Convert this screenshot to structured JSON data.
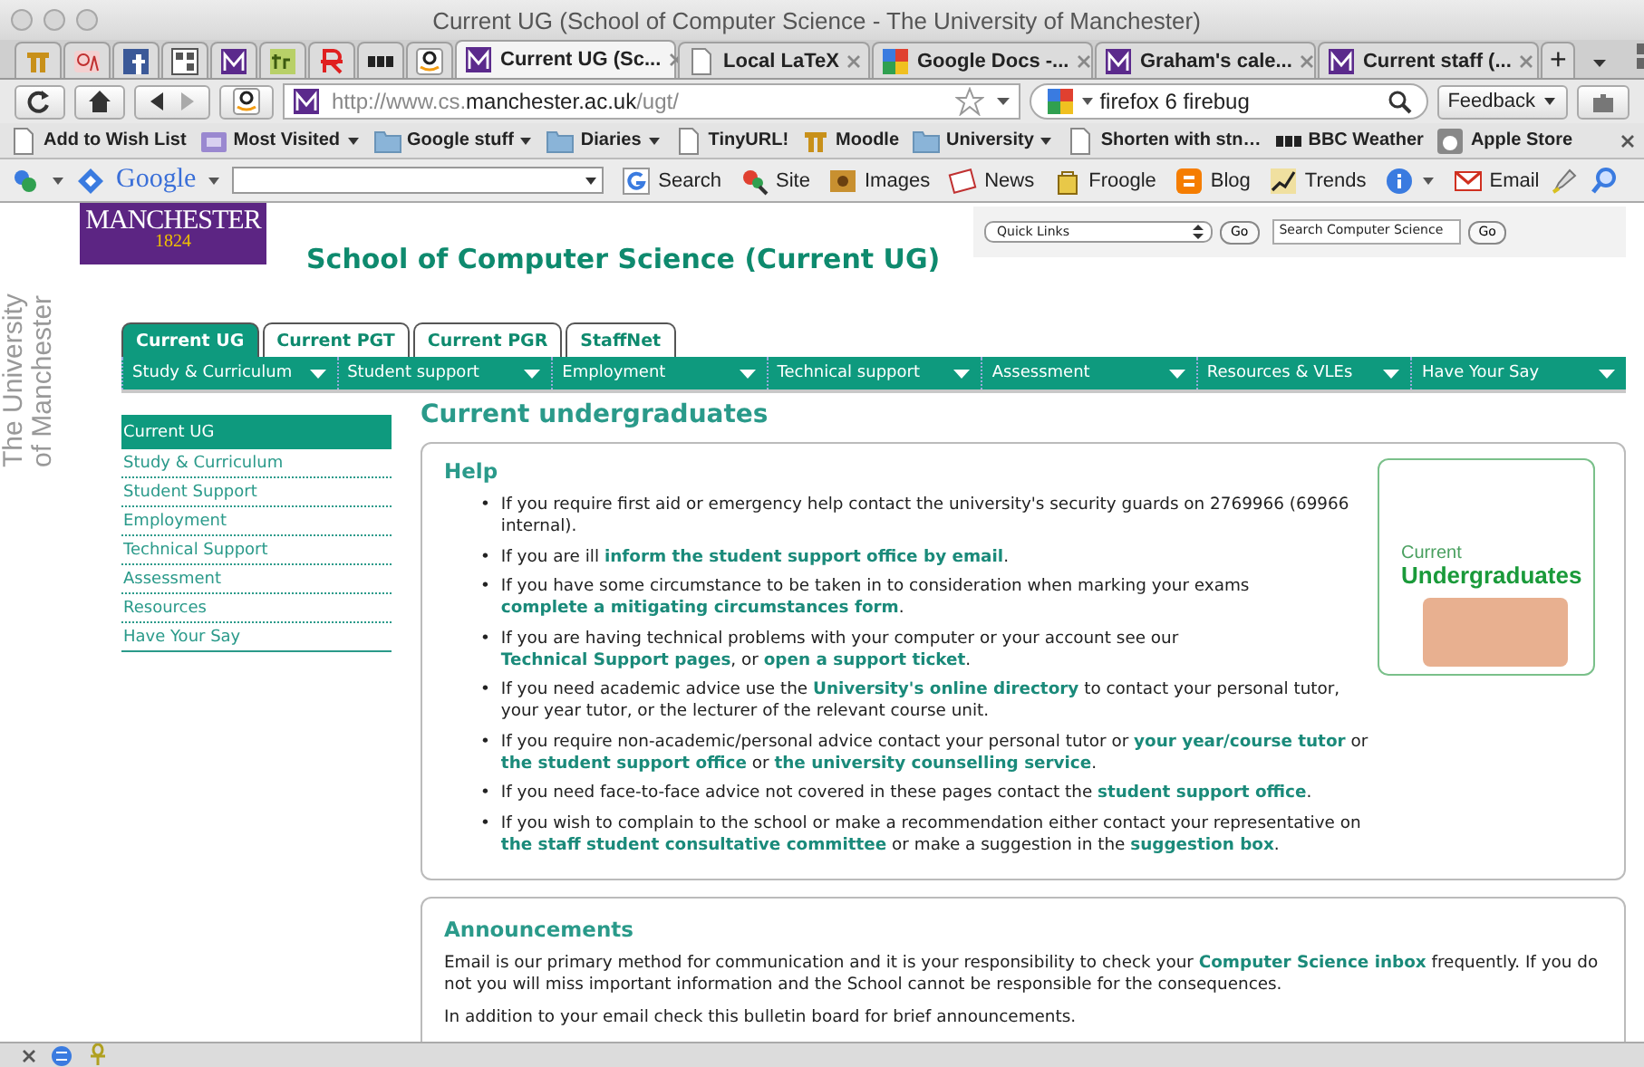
{
  "window": {
    "title": "Current UG (School of Computer Science - The University of Manchester)"
  },
  "browser_tabs": [
    {
      "kind": "pinned",
      "selected": false
    },
    {
      "kind": "pinned",
      "selected": false
    },
    {
      "kind": "pinned",
      "selected": false
    },
    {
      "kind": "pinned",
      "selected": false
    },
    {
      "kind": "pinned",
      "selected": false
    },
    {
      "kind": "pinned",
      "selected": false
    },
    {
      "kind": "pinned",
      "selected": false
    },
    {
      "kind": "pinned",
      "selected": false
    },
    {
      "kind": "pinned",
      "selected": false
    },
    {
      "kind": "tab",
      "label": "Current UG (Sc...",
      "selected": true
    },
    {
      "kind": "tab",
      "label": "Local LaTeX",
      "selected": false
    },
    {
      "kind": "tab",
      "label": "Google Docs -...",
      "selected": false
    },
    {
      "kind": "tab",
      "label": "Graham's cale...",
      "selected": false
    },
    {
      "kind": "tab",
      "label": "Current staff (...",
      "selected": false
    }
  ],
  "new_tab": "+",
  "navigation": {
    "url_prefix": "http://www.cs.",
    "url_host": "manchester.ac.uk",
    "url_path": "/ugt/",
    "search_value": "firefox 6 firebug",
    "feedback": "Feedback"
  },
  "bookmarks": [
    {
      "kind": "page",
      "label": "Add to Wish List",
      "dropdown": false
    },
    {
      "kind": "smart",
      "label": "Most Visited",
      "dropdown": true
    },
    {
      "kind": "folder",
      "label": "Google stuff",
      "dropdown": true
    },
    {
      "kind": "folder",
      "label": "Diaries",
      "dropdown": true
    },
    {
      "kind": "page",
      "label": "TinyURL!",
      "dropdown": false
    },
    {
      "kind": "site",
      "label": "Moodle",
      "dropdown": false
    },
    {
      "kind": "folder",
      "label": "University",
      "dropdown": true
    },
    {
      "kind": "page",
      "label": "Shorten with stn…",
      "dropdown": false
    },
    {
      "kind": "bbc",
      "label": "BBC Weather",
      "dropdown": false
    },
    {
      "kind": "apple",
      "label": "Apple Store",
      "dropdown": false
    }
  ],
  "google_toolbar": {
    "brand": "Google",
    "items": [
      {
        "kind": "search",
        "label": "Search"
      },
      {
        "kind": "site",
        "label": "Site"
      },
      {
        "kind": "images",
        "label": "Images"
      },
      {
        "kind": "news",
        "label": "News"
      },
      {
        "kind": "froogle",
        "label": "Froogle"
      },
      {
        "kind": "blog",
        "label": "Blog"
      },
      {
        "kind": "trends",
        "label": "Trends"
      },
      {
        "kind": "info"
      },
      {
        "kind": "email",
        "label": "Email"
      }
    ]
  },
  "site": {
    "logo_name": "MANCHESTER",
    "logo_year": "1824",
    "side_brand": [
      "The University",
      "of Manchester"
    ],
    "title": "School of Computer Science (Current UG)",
    "quick_links": "Quick Links",
    "go": "Go",
    "search_value": "Search Computer Science",
    "search_go": "Go"
  },
  "site_tabs": [
    {
      "label": "Current UG",
      "selected": true
    },
    {
      "label": "Current PGT",
      "selected": false
    },
    {
      "label": "Current PGR",
      "selected": false
    },
    {
      "label": "StaffNet",
      "selected": false
    }
  ],
  "menu": [
    "Study & Curriculum",
    "Student support",
    "Employment",
    "Technical support",
    "Assessment",
    "Resources & VLEs",
    "Have Your Say"
  ],
  "sidebar": [
    {
      "label": "Current UG",
      "selected": true
    },
    {
      "label": "Study & Curriculum",
      "selected": false
    },
    {
      "label": "Student Support",
      "selected": false
    },
    {
      "label": "Employment",
      "selected": false
    },
    {
      "label": "Technical Support",
      "selected": false
    },
    {
      "label": "Assessment",
      "selected": false
    },
    {
      "label": "Resources",
      "selected": false
    },
    {
      "label": "Have Your Say",
      "selected": false
    }
  ],
  "heading": "Current undergraduates",
  "help": {
    "title": "Help",
    "bullet": "•",
    "promo": [
      "Current",
      "Undergraduates"
    ],
    "items": [
      "If you require first aid or emergency help contact the university's security guards on 2769966 (69966 internal).",
      "If you are ill **inform the student support office by email**.",
      "If you have some circumstance to be taken in to consideration when marking your exams **complete a mitigating circumstances form**.",
      "If you are having technical problems with your computer or your account see our **Technical Support pages**, or **open a support ticket**.",
      "If you need academic advice use the **University's online directory** to contact your personal tutor, your year tutor, or the lecturer of the relevant course unit.",
      "If you require non-academic/personal advice contact your personal tutor or **your year/course tutor** or **the student support office** or **the university counselling service**.",
      "If you need face-to-face advice not covered in these pages contact the **student support office**.",
      "If you wish to complain to the school or make a recommendation either contact your representative on **the staff student consultative committee** or make a suggestion in the **suggestion box**."
    ]
  },
  "announcements": {
    "title": "Announcements",
    "paragraphs": [
      "Email is our primary method for communication and it is your responsibility to check your **Computer Science inbox** frequently. If you do not you will miss important information and the School cannot be responsible for the consequences.",
      "In addition to your email check this bulletin board for brief announcements."
    ]
  }
}
